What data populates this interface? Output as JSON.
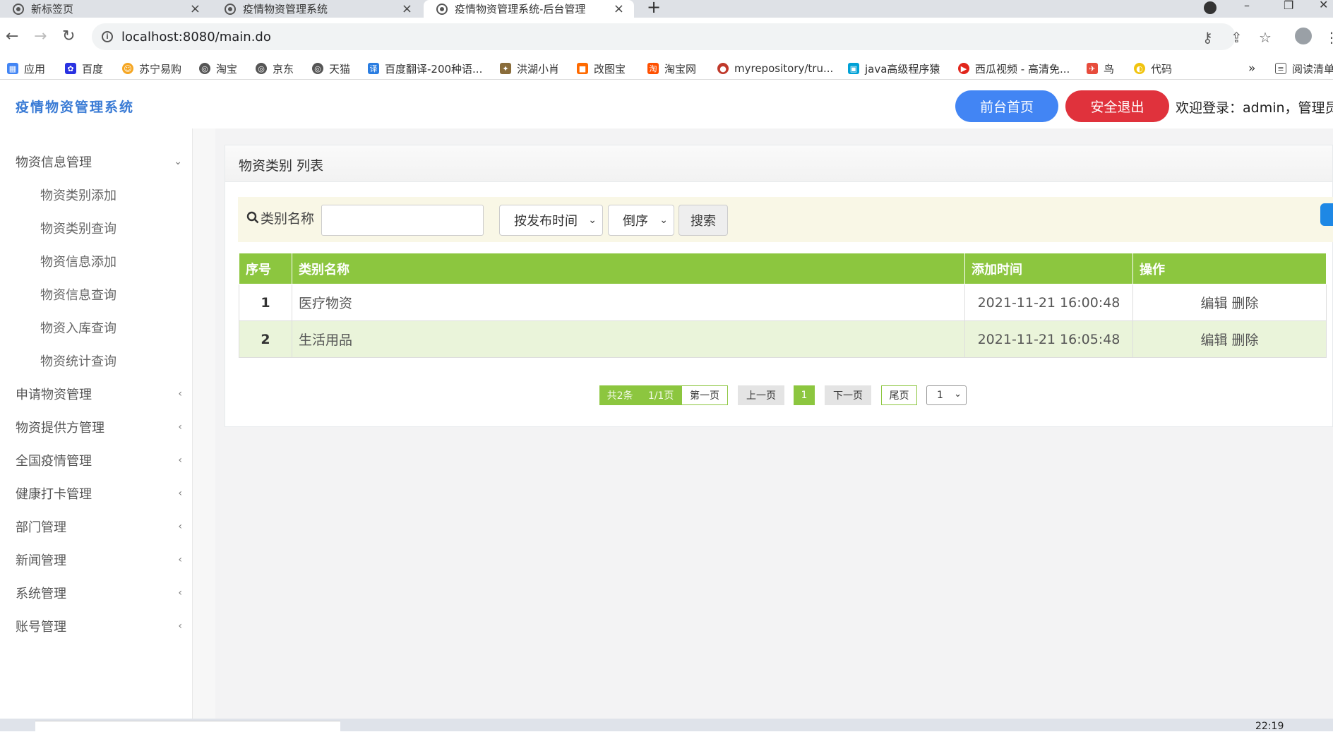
{
  "browser": {
    "tabs": [
      {
        "title": "新标签页",
        "active": false
      },
      {
        "title": "疫情物资管理系统",
        "active": false
      },
      {
        "title": "疫情物资管理系统-后台管理",
        "active": true
      }
    ],
    "new_tab": "+",
    "url": "localhost:8080/main.do",
    "bookmarks": [
      {
        "label": "应用",
        "icon": "apps-grid-icon",
        "color": "#4285f4"
      },
      {
        "label": "百度",
        "icon": "baidu-paw-icon",
        "color": "#2932e1"
      },
      {
        "label": "苏宁易购",
        "icon": "suning-icon",
        "color": "#f5a623"
      },
      {
        "label": "淘宝",
        "icon": "globe-icon",
        "color": "#555555"
      },
      {
        "label": "京东",
        "icon": "globe-icon",
        "color": "#555555"
      },
      {
        "label": "天猫",
        "icon": "globe-icon",
        "color": "#555555"
      },
      {
        "label": "百度翻译-200种语...",
        "icon": "translate-icon",
        "color": "#2a7de1"
      },
      {
        "label": "洪湖小肖",
        "icon": "bird-icon",
        "color": "#8a6d3b"
      },
      {
        "label": "改图宝",
        "icon": "image-edit-icon",
        "color": "#ff6a00"
      },
      {
        "label": "淘宝网",
        "icon": "taobao-icon",
        "color": "#ff5000"
      },
      {
        "label": "myrepository/tru...",
        "icon": "repo-icon",
        "color": "#c0392b"
      },
      {
        "label": "java高级程序猿",
        "icon": "tv-icon",
        "color": "#00a1d6"
      },
      {
        "label": "西瓜视频 - 高清免...",
        "icon": "video-icon",
        "color": "#e1251b"
      },
      {
        "label": "鸟",
        "icon": "bird-icon",
        "color": "#e74c3c"
      },
      {
        "label": "代码",
        "icon": "code-icon",
        "color": "#f1c40f"
      }
    ],
    "more_bookmarks": "»",
    "reading_list": "阅读清单"
  },
  "header": {
    "brand": "疫情物资管理系统",
    "home_button": "前台首页",
    "logout_button": "安全退出",
    "welcome": "欢迎登录：admin，管理员",
    "home_color": "#4285f4",
    "logout_color": "#e0323c"
  },
  "sidebar": {
    "groups": [
      {
        "label": "物资信息管理",
        "expanded": true,
        "items": [
          "物资类别添加",
          "物资类别查询",
          "物资信息添加",
          "物资信息查询",
          "物资入库查询",
          "物资统计查询"
        ]
      },
      {
        "label": "申请物资管理",
        "expanded": false
      },
      {
        "label": "物资提供方管理",
        "expanded": false
      },
      {
        "label": "全国疫情管理",
        "expanded": false
      },
      {
        "label": "健康打卡管理",
        "expanded": false
      },
      {
        "label": "部门管理",
        "expanded": false
      },
      {
        "label": "新闻管理",
        "expanded": false
      },
      {
        "label": "系统管理",
        "expanded": false
      },
      {
        "label": "账号管理",
        "expanded": false
      }
    ]
  },
  "panel": {
    "title": "物资类别 列表",
    "search": {
      "label": "类别名称",
      "input_value": "",
      "sort_field": "按发布时间",
      "sort_order": "倒序",
      "button": "搜索"
    },
    "table": {
      "header_color": "#8cc63f",
      "columns": [
        "序号",
        "类别名称",
        "添加时间",
        "操作"
      ],
      "rows": [
        {
          "no": "1",
          "name": "医疗物资",
          "time": "2021-11-21 16:00:48",
          "edit": "编辑",
          "delete": "删除"
        },
        {
          "no": "2",
          "name": "生活用品",
          "time": "2021-11-21 16:05:48",
          "edit": "编辑",
          "delete": "删除"
        }
      ]
    },
    "pagination": {
      "total": "共2条",
      "pages": "1/1页",
      "first": "第一页",
      "prev": "上一页",
      "current": "1",
      "next": "下一页",
      "last": "尾页",
      "jump_value": "1"
    }
  },
  "taskbar": {
    "clock": "22:19"
  }
}
